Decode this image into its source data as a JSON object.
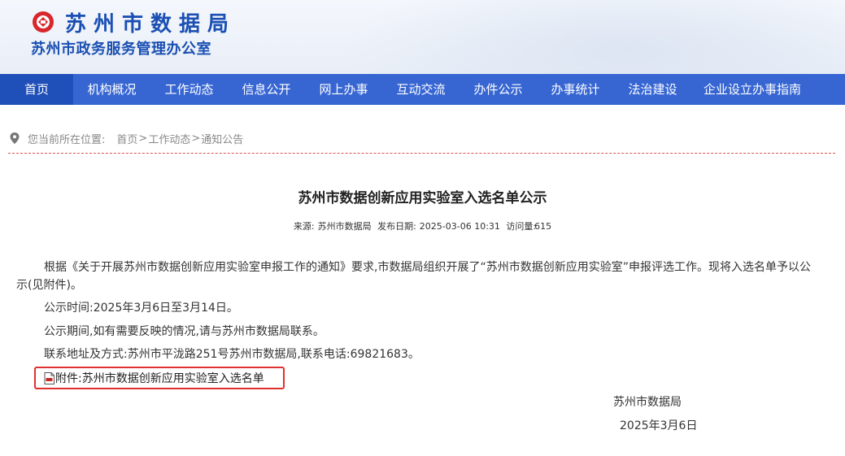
{
  "header": {
    "title": "苏州市数据局",
    "subtitle": "苏州市政务服务管理办公室",
    "brand_color": "#1a4fb3"
  },
  "nav": {
    "items": [
      {
        "label": "首页",
        "active": true
      },
      {
        "label": "机构概况"
      },
      {
        "label": "工作动态"
      },
      {
        "label": "信息公开"
      },
      {
        "label": "网上办事"
      },
      {
        "label": "互动交流"
      },
      {
        "label": "办件公示"
      },
      {
        "label": "办事统计"
      },
      {
        "label": "法治建设"
      },
      {
        "label": "企业设立办事指南"
      }
    ],
    "bg_color": "#3766d3",
    "active_color": "#1f4fb8"
  },
  "breadcrumb": {
    "icon": "location-pin-icon",
    "label": "您当前所在位置:",
    "items": [
      "首页",
      "工作动态",
      "通知公告"
    ],
    "separator": ">"
  },
  "article": {
    "title": "苏州市数据创新应用实验室入选名单公示",
    "source_label": "来源:",
    "source": "苏州市数据局",
    "date_label": "发布日期:",
    "date": "2025-03-06 10:31",
    "views_label": "访问量:",
    "views": "615",
    "paragraphs": [
      "根据《关于开展苏州市数据创新应用实验室申报工作的通知》要求,市数据局组织开展了“苏州市数据创新应用实验室”申报评选工作。现将入选名单予以公示(见附件)。",
      "公示时间:2025年3月6日至3月14日。",
      "公示期间,如有需要反映的情况,请与苏州市数据局联系。",
      "联系地址及方式:苏州市平泷路251号苏州市数据局,联系电话:69821683。"
    ],
    "attachment": {
      "icon": "pdf-file-icon",
      "label": "附件:苏州市数据创新应用实验室入选名单",
      "highlight_color": "#e03030"
    },
    "signature_org": "苏州市数据局",
    "signature_date": "2025年3月6日"
  }
}
